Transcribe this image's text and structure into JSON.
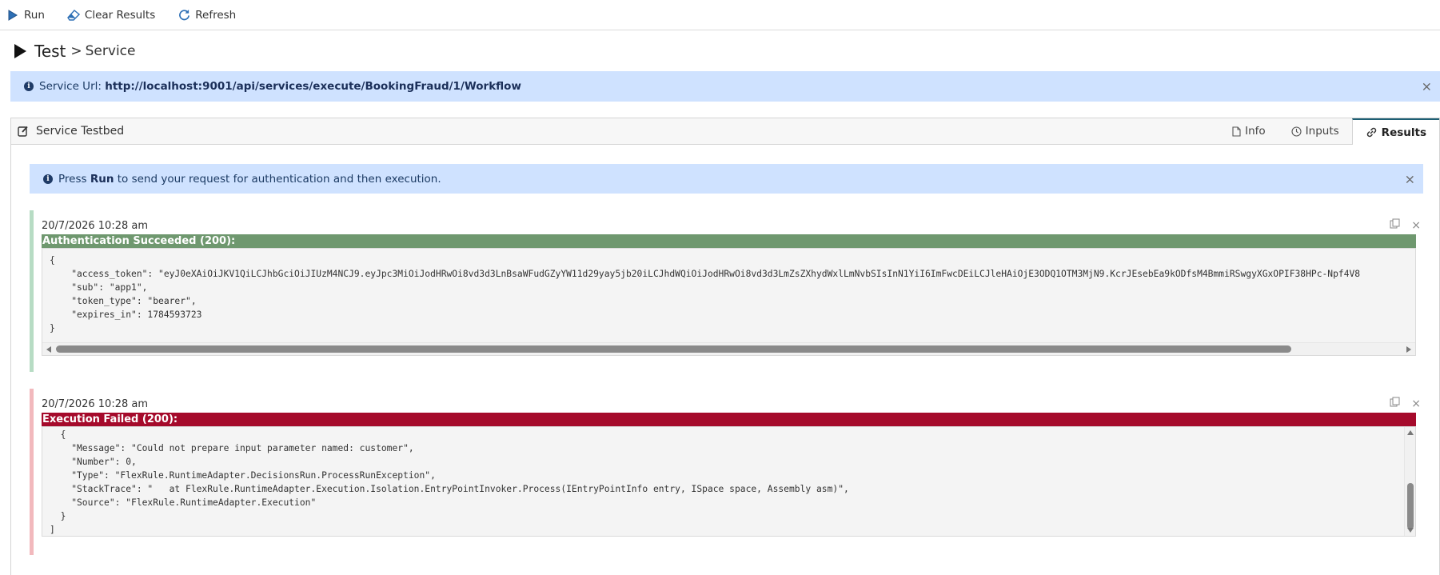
{
  "toolbar": {
    "run_label": "Run",
    "clear_label": "Clear Results",
    "refresh_label": "Refresh"
  },
  "breadcrumb": {
    "title": "Test",
    "separator": ">",
    "current": "Service"
  },
  "service_banner": {
    "label": "Service Url:",
    "url": "http://localhost:9001/api/services/execute/BookingFraud/1/Workflow",
    "close": "×"
  },
  "panel": {
    "title": "Service Testbed",
    "tabs": [
      {
        "label": "Info",
        "icon": "file-icon"
      },
      {
        "label": "Inputs",
        "icon": "clock-icon"
      },
      {
        "label": "Results",
        "icon": "link-icon",
        "active": true
      }
    ]
  },
  "run_banner": {
    "prefix": "Press",
    "bold": "Run",
    "suffix": "to send your request for authentication and then execution.",
    "close": "×"
  },
  "results": [
    {
      "timestamp": "20/7/2026 10:28 am",
      "status": "Authentication Succeeded (200):",
      "status_color": "#6f986f",
      "accent_color": "#b7dcc4",
      "body": "{\n    \"access_token\": \"eyJ0eXAiOiJKV1QiLCJhbGciOiJIUzM4NCJ9.eyJpc3MiOiJodHRwOi8vd3d3LnBsaWFudGZyYW11d29yay5jb20iLCJhdWQiOiJodHRwOi8vd3d3LmZsZXhydWxlLmNvbSIsInN1YiI6ImFwcDEiLCJleHAiOjE3ODQ1OTM3MjN9.KcrJEsebEa9kODfsM4BmmiRSwgyXGxOPIF38HPc-Npf4V8\n    \"sub\": \"app1\",\n    \"token_type\": \"bearer\",\n    \"expires_in\": 1784593723\n}"
    },
    {
      "timestamp": "20/7/2026 10:28 am",
      "status": "Execution Failed (200):",
      "status_color": "#a50a2b",
      "accent_color": "#f2b9bd",
      "body": "  {\n    \"Message\": \"Could not prepare input parameter named: customer\",\n    \"Number\": 0,\n    \"Type\": \"FlexRule.RuntimeAdapter.DecisionsRun.ProcessRunException\",\n    \"StackTrace\": \"   at FlexRule.RuntimeAdapter.Execution.Isolation.EntryPointInvoker.Process(IEntryPointInfo entry, ISpace space, Assembly asm)\",\n    \"Source\": \"FlexRule.RuntimeAdapter.Execution\"\n  }\n]"
    }
  ]
}
